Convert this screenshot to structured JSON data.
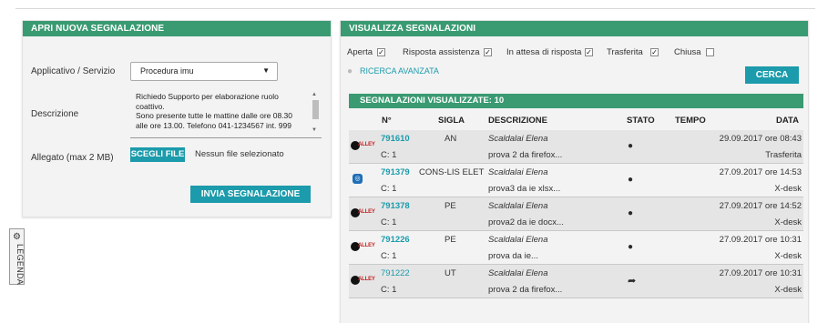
{
  "new_ticket": {
    "title": "APRI NUOVA SEGNALAZIONE",
    "app_label": "Applicativo / Servizio",
    "app_value": "Procedura imu",
    "desc_label": "Descrizione",
    "desc_lines": [
      "Richiedo Supporto per elaborazione ruolo",
      "coattivo.",
      "Sono presente tutte le mattine dalle ore 08.30",
      "alle ore 13.00. Telefono 041-1234567 int. 999"
    ],
    "attach_label": "Allegato (max 2 MB)",
    "choose_file": "SCEGLI FILE",
    "no_file": "Nessun file selezionato",
    "submit": "INVIA SEGNALAZIONE"
  },
  "legend": {
    "label": "LEGENDA",
    "icon": "gear-icon"
  },
  "view": {
    "title": "VISUALIZZA SEGNALAZIONI",
    "filters": [
      {
        "label": "Aperta",
        "checked": true
      },
      {
        "label": "Risposta assistenza",
        "checked": true
      },
      {
        "label": "In attesa di risposta",
        "checked": true
      },
      {
        "label": "Trasferita",
        "checked": true
      },
      {
        "label": "Chiusa",
        "checked": false
      }
    ],
    "advanced_search": "RICERCA AVANZATA",
    "search_button": "CERCA",
    "results_title": "SEGNALAZIONI VISUALIZZATE: 10",
    "columns": {
      "num": "N°",
      "sigla": "SIGLA",
      "descrizione": "DESCRIZIONE",
      "stato": "STATO",
      "tempo": "TEMPO",
      "data": "DATA"
    },
    "rows": [
      {
        "logo": "halley-logo",
        "num": "791610",
        "count": "C: 1",
        "sigla": "AN",
        "author": "Scaldalai Elena",
        "desc": "prova 2 da firefox...",
        "stato_icon": "chat-icon",
        "date": "29.09.2017 ore 08:43",
        "status": "Trasferita"
      },
      {
        "logo": "cons-logo",
        "num": "791379",
        "count": "C: 1",
        "sigla": "CONS-LIS ELET",
        "author": "Scaldalai Elena",
        "desc": "prova3 da ie xlsx...",
        "stato_icon": "chat-icon",
        "date": "27.09.2017 ore 14:53",
        "status": "X-desk"
      },
      {
        "logo": "halley-logo",
        "num": "791378",
        "count": "C: 1",
        "sigla": "PE",
        "author": "Scaldalai Elena",
        "desc": "prova2 da ie docx...",
        "stato_icon": "chat-icon",
        "date": "27.09.2017 ore 14:52",
        "status": "X-desk"
      },
      {
        "logo": "halley-logo",
        "num": "791226",
        "count": "C: 1",
        "sigla": "PE",
        "author": "Scaldalai Elena",
        "desc": "prova da ie...",
        "stato_icon": "chat-icon",
        "date": "27.09.2017 ore 10:31",
        "status": "X-desk"
      },
      {
        "logo": "halley-logo",
        "num": "791222",
        "count": "C: 1",
        "sigla": "UT",
        "author": "Scaldalai Elena",
        "desc": "prova 2 da firefox...",
        "stato_icon": "forward-arrow-icon",
        "date": "27.09.2017 ore 10:31",
        "status": "X-desk"
      }
    ]
  }
}
